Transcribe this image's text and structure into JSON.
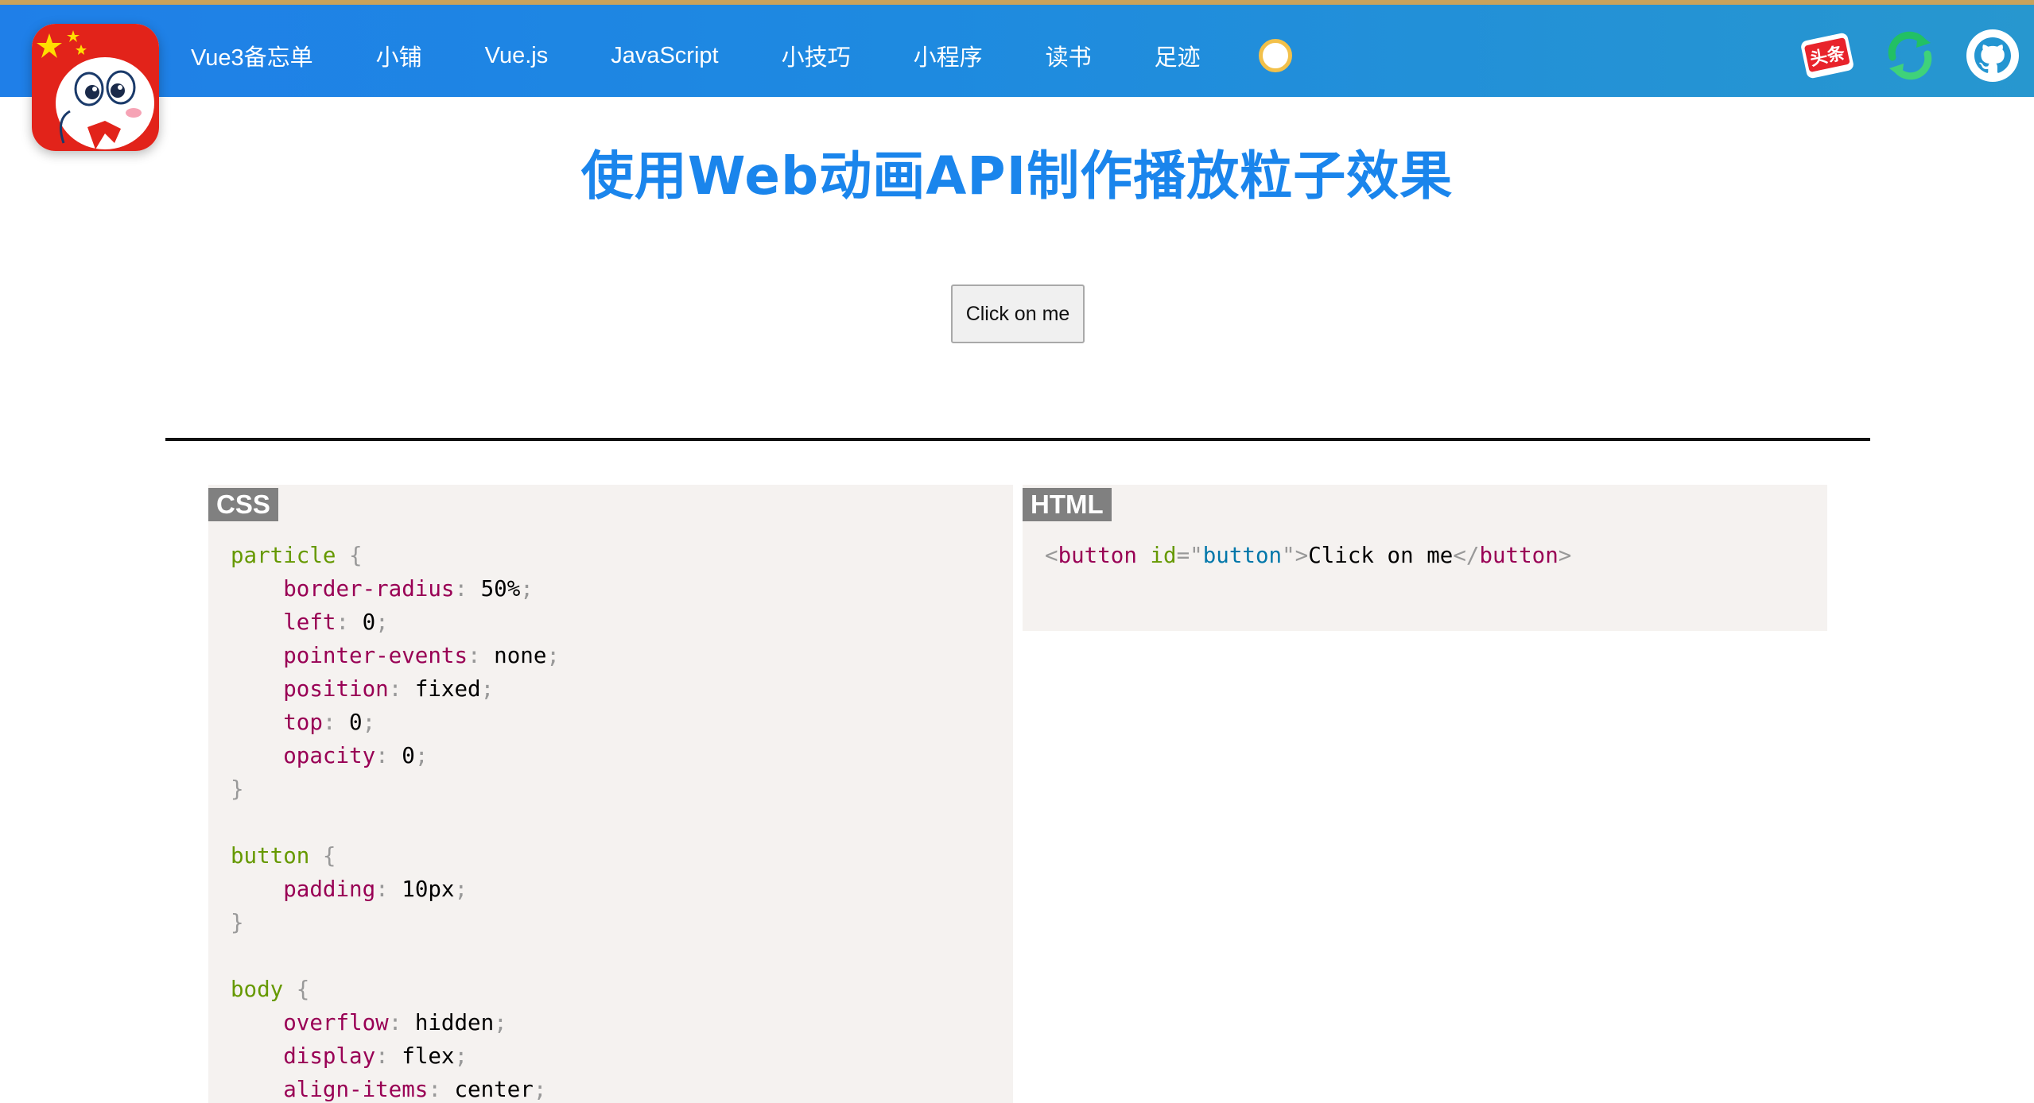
{
  "header": {
    "nav": [
      {
        "label": "Vue3备忘单"
      },
      {
        "label": "小铺"
      },
      {
        "label": "Vue.js"
      },
      {
        "label": "JavaScript"
      },
      {
        "label": "小技巧"
      },
      {
        "label": "小程序"
      },
      {
        "label": "读书"
      },
      {
        "label": "足迹"
      }
    ],
    "toutiao_label": "头条",
    "icons": [
      "logo-avatar",
      "theme-toggle",
      "toutiao-icon",
      "refresh-icon",
      "github-icon"
    ]
  },
  "page_title": "使用Web动画API制作播放粒子效果",
  "demo_button_label": "Click on me",
  "css_panel": {
    "label": "CSS",
    "rules": [
      {
        "selector": "particle",
        "decls": [
          {
            "prop": "border-radius",
            "value": "50%"
          },
          {
            "prop": "left",
            "value": "0"
          },
          {
            "prop": "pointer-events",
            "value": "none"
          },
          {
            "prop": "position",
            "value": "fixed"
          },
          {
            "prop": "top",
            "value": "0"
          },
          {
            "prop": "opacity",
            "value": "0"
          }
        ]
      },
      {
        "selector": "button",
        "decls": [
          {
            "prop": "padding",
            "value": "10px"
          }
        ]
      },
      {
        "selector": "body",
        "decls": [
          {
            "prop": "overflow",
            "value": "hidden"
          },
          {
            "prop": "display",
            "value": "flex"
          },
          {
            "prop": "align-items",
            "value": "center"
          }
        ]
      }
    ]
  },
  "html_panel": {
    "label": "HTML",
    "tag": "button",
    "attr_name": "id",
    "attr_value": "button",
    "text": "Click on me"
  },
  "colors": {
    "header_start": "#1f7fe8",
    "header_end": "#2797cf",
    "title": "#1a85ec",
    "code_bg": "#f5f2f0",
    "selector": "#669900",
    "property": "#990055",
    "string": "#0077aa"
  }
}
